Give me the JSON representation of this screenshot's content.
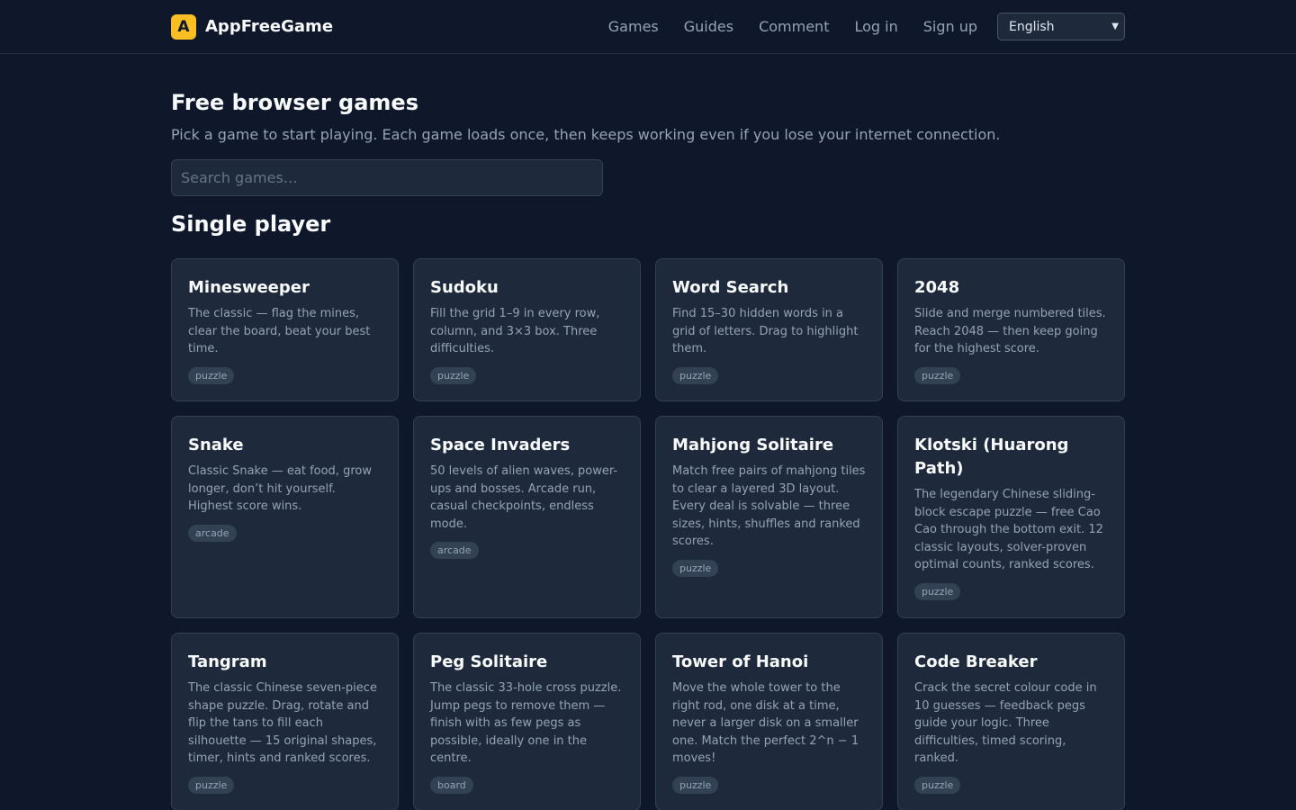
{
  "header": {
    "logo_letter": "A",
    "brand": "AppFreeGame",
    "nav": [
      "Games",
      "Guides",
      "Comment",
      "Log in",
      "Sign up"
    ],
    "language": "English"
  },
  "page": {
    "title": "Free browser games",
    "subtitle": "Pick a game to start playing. Each game loads once, then keeps working even if you lose your internet connection.",
    "search_placeholder": "Search games…"
  },
  "section": {
    "title": "Single player"
  },
  "games": [
    {
      "title": "Minesweeper",
      "desc": "The classic — flag the mines, clear the board, beat your best time.",
      "tag": "puzzle"
    },
    {
      "title": "Sudoku",
      "desc": "Fill the grid 1–9 in every row, column, and 3×3 box. Three difficulties.",
      "tag": "puzzle"
    },
    {
      "title": "Word Search",
      "desc": "Find 15–30 hidden words in a grid of letters. Drag to highlight them.",
      "tag": "puzzle"
    },
    {
      "title": "2048",
      "desc": "Slide and merge numbered tiles. Reach 2048 — then keep going for the highest score.",
      "tag": "puzzle"
    },
    {
      "title": "Snake",
      "desc": "Classic Snake — eat food, grow longer, don’t hit yourself. Highest score wins.",
      "tag": "arcade"
    },
    {
      "title": "Space Invaders",
      "desc": "50 levels of alien waves, power-ups and bosses. Arcade run, casual checkpoints, endless mode.",
      "tag": "arcade"
    },
    {
      "title": "Mahjong Solitaire",
      "desc": "Match free pairs of mahjong tiles to clear a layered 3D layout. Every deal is solvable — three sizes, hints, shuffles and ranked scores.",
      "tag": "puzzle"
    },
    {
      "title": "Klotski (Huarong Path)",
      "desc": "The legendary Chinese sliding-block escape puzzle — free Cao Cao through the bottom exit. 12 classic layouts, solver-proven optimal counts, ranked scores.",
      "tag": "puzzle"
    },
    {
      "title": "Tangram",
      "desc": "The classic Chinese seven-piece shape puzzle. Drag, rotate and flip the tans to fill each silhouette — 15 original shapes, timer, hints and ranked scores.",
      "tag": "puzzle"
    },
    {
      "title": "Peg Solitaire",
      "desc": "The classic 33-hole cross puzzle. Jump pegs to remove them — finish with as few pegs as possible, ideally one in the centre.",
      "tag": "board"
    },
    {
      "title": "Tower of Hanoi",
      "desc": "Move the whole tower to the right rod, one disk at a time, never a larger disk on a smaller one. Match the perfect 2^n − 1 moves!",
      "tag": "puzzle"
    },
    {
      "title": "Code Breaker",
      "desc": "Crack the secret colour code in 10 guesses — feedback pegs guide your logic. Three difficulties, timed scoring, ranked.",
      "tag": "puzzle"
    }
  ]
}
